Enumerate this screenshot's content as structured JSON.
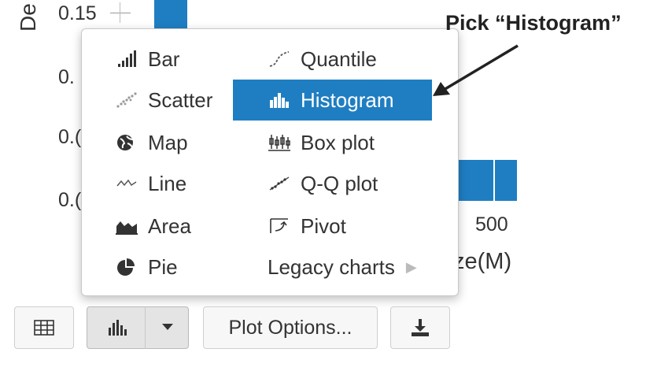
{
  "chart": {
    "y_label": "De",
    "y_ticks": [
      "0.15",
      "0.",
      "0.(",
      "0.("
    ],
    "x_tick": "500",
    "x_label": "ze(M)"
  },
  "menu": {
    "left_column": [
      {
        "label": "Bar",
        "icon": "bar-chart-icon"
      },
      {
        "label": "Scatter",
        "icon": "scatter-icon"
      },
      {
        "label": "Map",
        "icon": "globe-icon"
      },
      {
        "label": "Line",
        "icon": "line-chart-icon"
      },
      {
        "label": "Area",
        "icon": "area-chart-icon"
      },
      {
        "label": "Pie",
        "icon": "pie-chart-icon"
      }
    ],
    "right_column": [
      {
        "label": "Quantile",
        "icon": "quantile-icon"
      },
      {
        "label": "Histogram",
        "icon": "histogram-icon",
        "selected": true
      },
      {
        "label": "Box plot",
        "icon": "box-plot-icon"
      },
      {
        "label": "Q-Q plot",
        "icon": "qq-plot-icon"
      },
      {
        "label": "Pivot",
        "icon": "pivot-icon"
      },
      {
        "label": "Legacy charts",
        "icon": "chevron-right-icon"
      }
    ]
  },
  "toolbar": {
    "plot_options_label": "Plot Options..."
  },
  "annotation": {
    "text": "Pick “Histogram”"
  },
  "colors": {
    "accent": "#1f7ec2",
    "menu_border": "#c8c8c8",
    "text": "#333333"
  }
}
